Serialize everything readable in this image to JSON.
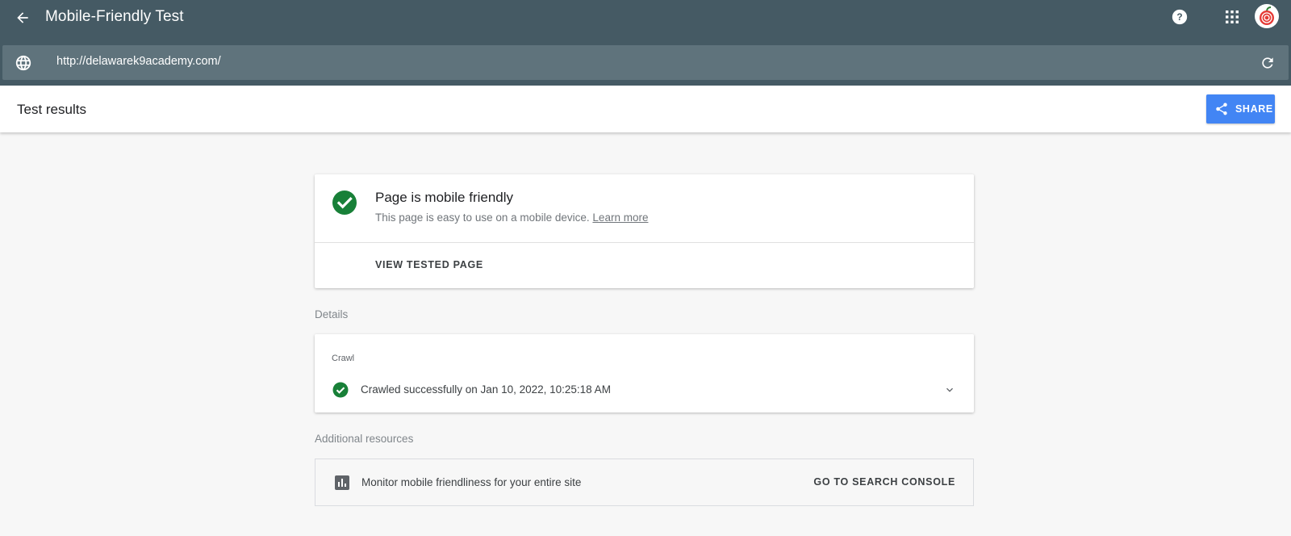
{
  "appbar": {
    "title": "Mobile-Friendly Test",
    "icons": [
      "back-arrow-icon",
      "help-icon",
      "apps-grid-icon",
      "avatar"
    ]
  },
  "urlbar": {
    "url": "http://delawarek9academy.com/",
    "icons": [
      "globe-icon",
      "reload-icon"
    ]
  },
  "results": {
    "title": "Test results",
    "share_label": "SHARE"
  },
  "summary": {
    "heading": "Page is mobile friendly",
    "description": "This page is easy to use on a mobile device.",
    "learn_more": "Learn more",
    "view_tested_page": "VIEW TESTED PAGE"
  },
  "details": {
    "section_label": "Details",
    "crawl_label": "Crawl",
    "crawl_status": "Crawled successfully on Jan 10, 2022, 10:25:18 AM"
  },
  "additional": {
    "section_label": "Additional resources",
    "monitor_text": "Monitor mobile friendliness for your entire site",
    "go_console": "GO TO SEARCH CONSOLE"
  },
  "colors": {
    "appbar": "#455a64",
    "urlbar": "#5f737c",
    "accent_blue": "#4285f4",
    "success_green": "#188038"
  }
}
